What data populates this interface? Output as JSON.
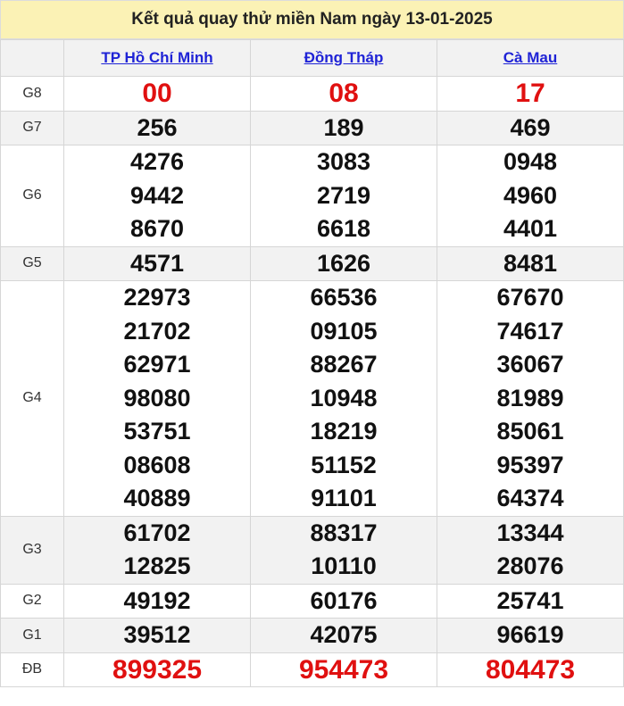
{
  "title": "Kết quả quay thử miền Nam ngày 13-01-2025",
  "provinces": [
    "TP Hồ Chí Minh",
    "Đồng Tháp",
    "Cà Mau"
  ],
  "rows": [
    {
      "label": "G8",
      "values": [
        [
          "00"
        ],
        [
          "08"
        ],
        [
          "17"
        ]
      ]
    },
    {
      "label": "G7",
      "values": [
        [
          "256"
        ],
        [
          "189"
        ],
        [
          "469"
        ]
      ]
    },
    {
      "label": "G6",
      "values": [
        [
          "4276",
          "9442",
          "8670"
        ],
        [
          "3083",
          "2719",
          "6618"
        ],
        [
          "0948",
          "4960",
          "4401"
        ]
      ]
    },
    {
      "label": "G5",
      "values": [
        [
          "4571"
        ],
        [
          "1626"
        ],
        [
          "8481"
        ]
      ]
    },
    {
      "label": "G4",
      "values": [
        [
          "22973",
          "21702",
          "62971",
          "98080",
          "53751",
          "08608",
          "40889"
        ],
        [
          "66536",
          "09105",
          "88267",
          "10948",
          "18219",
          "51152",
          "91101"
        ],
        [
          "67670",
          "74617",
          "36067",
          "81989",
          "85061",
          "95397",
          "64374"
        ]
      ]
    },
    {
      "label": "G3",
      "values": [
        [
          "61702",
          "12825"
        ],
        [
          "88317",
          "10110"
        ],
        [
          "13344",
          "28076"
        ]
      ]
    },
    {
      "label": "G2",
      "values": [
        [
          "49192"
        ],
        [
          "60176"
        ],
        [
          "25741"
        ]
      ]
    },
    {
      "label": "G1",
      "values": [
        [
          "39512"
        ],
        [
          "42075"
        ],
        [
          "96619"
        ]
      ]
    },
    {
      "label": "ĐB",
      "values": [
        [
          "899325"
        ],
        [
          "954473"
        ],
        [
          "804473"
        ]
      ]
    }
  ],
  "colors": {
    "header_bg": "#fbf2b5",
    "highlight": "#e01010",
    "link": "#1f23d6",
    "alt_row": "#f2f2f2"
  }
}
